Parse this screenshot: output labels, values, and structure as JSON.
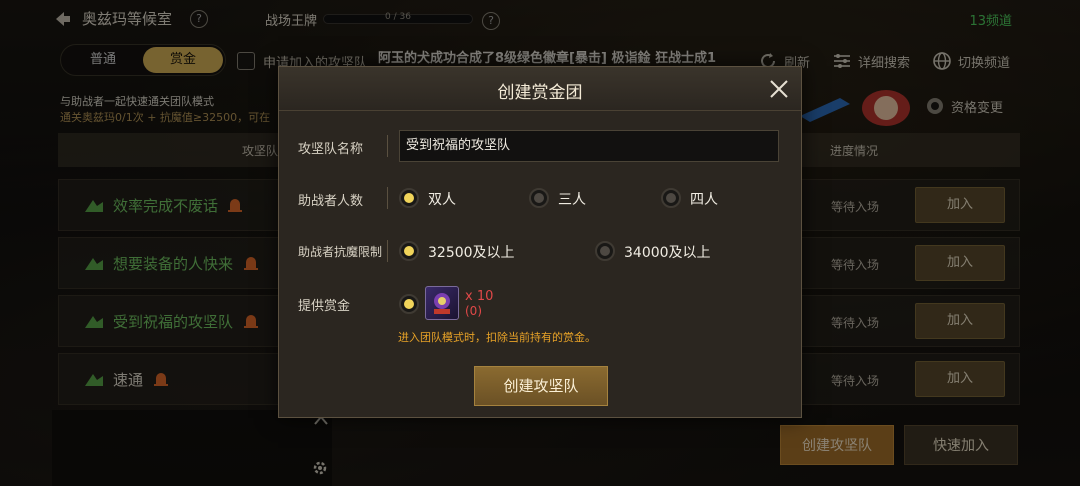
{
  "topbar": {
    "room_title": "奥兹玛等候室",
    "help_mark": "?",
    "battlefield_label": "战场王牌",
    "battlefield_progress": "0 / 36",
    "battlefield_fraction": 0,
    "channel": "13频道"
  },
  "tabs": [
    {
      "label": "普通",
      "active": false
    },
    {
      "label": "赏金",
      "active": true
    }
  ],
  "apply_checkbox_label": "申请加入的攻坚队",
  "marquee": "阿玉的犬成功合成了8级绿色徽章[暴击]      极诣鍂  狂战士成1",
  "actions": {
    "refresh": "刷新",
    "search": "详细搜索",
    "switch_channel": "切换频道",
    "qualification_change": "资格变更"
  },
  "description": {
    "line1": "与助战者一起快速通关团队模式",
    "line2": "通关奥兹玛0/1次 + 抗魔值≥32500，可在"
  },
  "list_header": {
    "col_name": "攻坚队",
    "col_progress": "进度情况"
  },
  "rows": [
    {
      "name": "效率完成不废话",
      "status": "等待入场",
      "join": "加入"
    },
    {
      "name": "想要装备的人快来",
      "status": "等待入场",
      "join": "加入"
    },
    {
      "name": "受到祝福的攻坚队",
      "status": "等待入场",
      "join": "加入"
    },
    {
      "name": "速通",
      "status": "等待入场",
      "join": "加入"
    }
  ],
  "bottom": {
    "create_button": "创建攻坚队",
    "quick_join_button": "快速加入"
  },
  "modal": {
    "title": "创建赏金团",
    "name_label": "攻坚队名称",
    "name_value": "受到祝福的攻坚队",
    "helper_count_label": "助战者人数",
    "helper_options": [
      {
        "label": "双人",
        "selected": true
      },
      {
        "label": "三人",
        "selected": false
      },
      {
        "label": "四人",
        "selected": false
      }
    ],
    "resist_label": "助战者抗魔限制",
    "resist_options": [
      {
        "label": "32500及以上",
        "selected": true
      },
      {
        "label": "34000及以上",
        "selected": false
      }
    ],
    "bounty_label": "提供赏金",
    "bounty_qty": "x 10",
    "bounty_owned": "(0)",
    "note": "进入团队模式时，扣除当前持有的赏金。",
    "create_button": "创建攻坚队"
  },
  "colors": {
    "accent_gold": "#d9b458",
    "row_name_green": "#74c964",
    "channel_green": "#4fd160",
    "warning_orange": "#e7a227",
    "error_red": "#e04848"
  }
}
